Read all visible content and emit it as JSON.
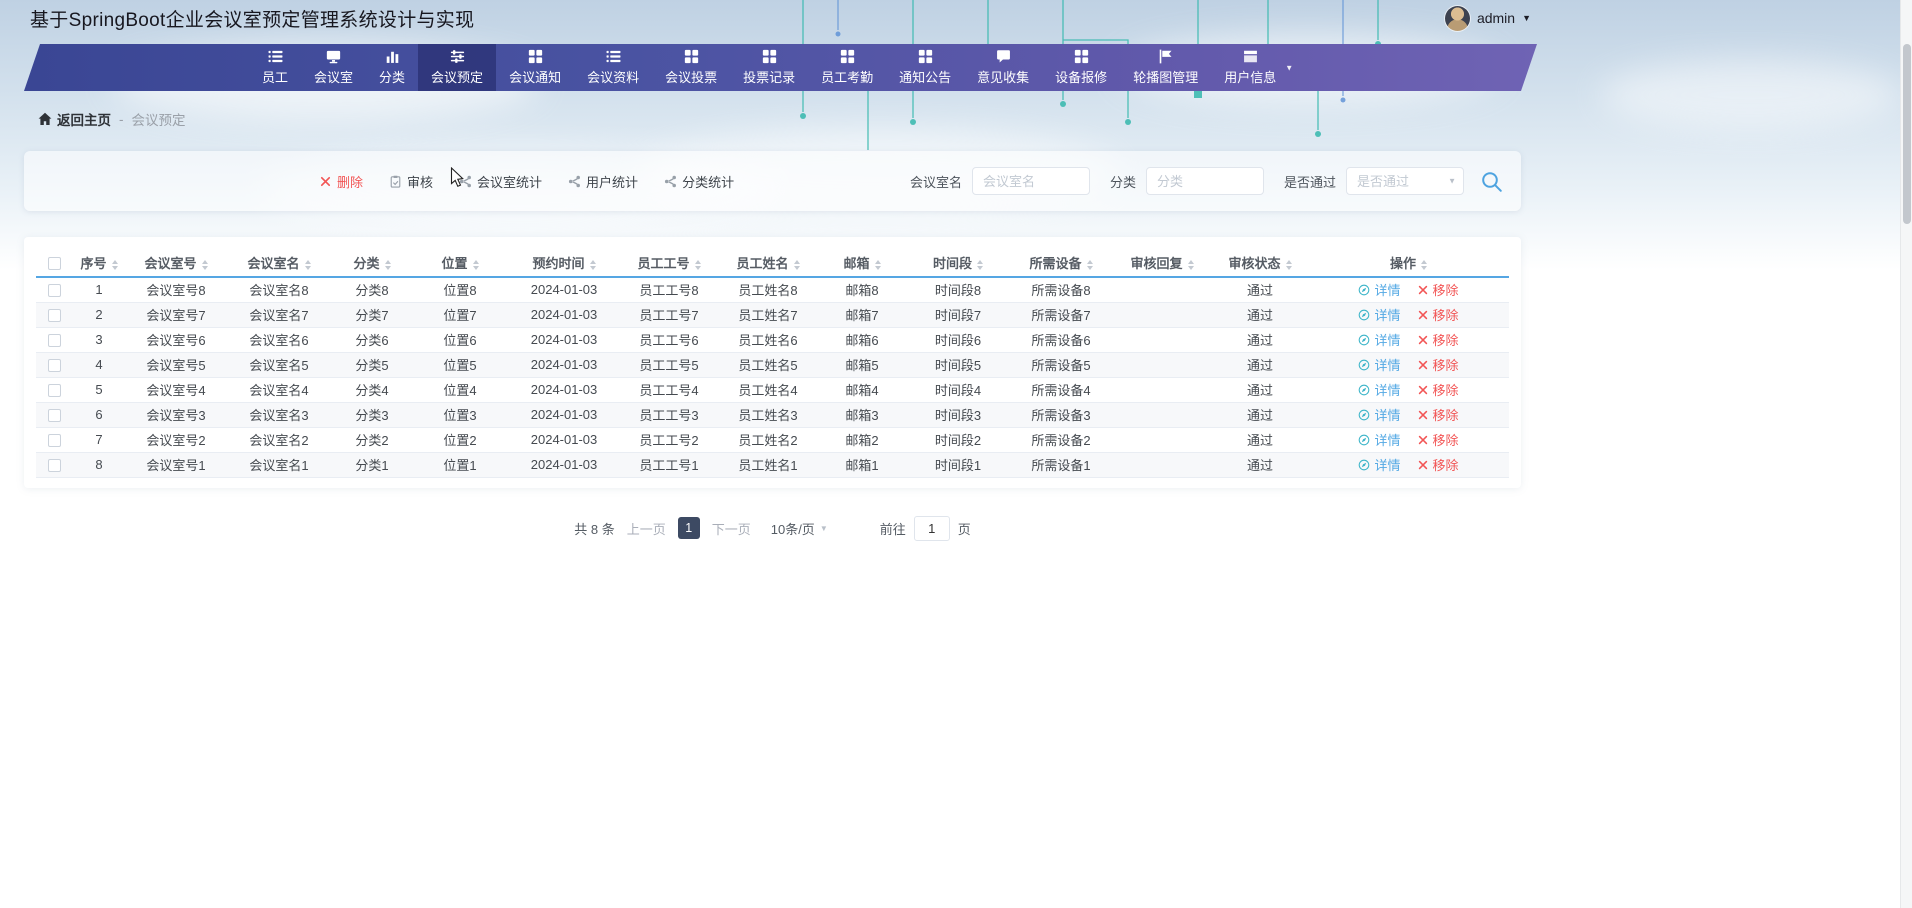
{
  "app": {
    "title": "基于SpringBoot企业会议室预定管理系统设计与实现",
    "user": {
      "name": "admin"
    }
  },
  "nav": {
    "items": [
      {
        "key": "staff",
        "label": "员工",
        "icon": "list-icon",
        "active": false,
        "caret": false
      },
      {
        "key": "meeting-room",
        "label": "会议室",
        "icon": "monitor-icon",
        "active": false,
        "caret": false
      },
      {
        "key": "category",
        "label": "分类",
        "icon": "bar-chart-icon",
        "active": false,
        "caret": false
      },
      {
        "key": "reservation",
        "label": "会议预定",
        "icon": "sliders-icon",
        "active": true,
        "caret": false
      },
      {
        "key": "meeting-notice",
        "label": "会议通知",
        "icon": "grid-icon",
        "active": false,
        "caret": false
      },
      {
        "key": "meeting-materials",
        "label": "会议资料",
        "icon": "list-icon",
        "active": false,
        "caret": false
      },
      {
        "key": "meeting-vote",
        "label": "会议投票",
        "icon": "grid-icon",
        "active": false,
        "caret": false
      },
      {
        "key": "vote-records",
        "label": "投票记录",
        "icon": "grid-icon",
        "active": false,
        "caret": false
      },
      {
        "key": "attendance",
        "label": "员工考勤",
        "icon": "grid-icon",
        "active": false,
        "caret": false
      },
      {
        "key": "announcements",
        "label": "通知公告",
        "icon": "grid-icon",
        "active": false,
        "caret": false
      },
      {
        "key": "feedback",
        "label": "意见收集",
        "icon": "chat-icon",
        "active": false,
        "caret": false
      },
      {
        "key": "equipment-repair",
        "label": "设备报修",
        "icon": "grid-icon",
        "active": false,
        "caret": false
      },
      {
        "key": "carousel",
        "label": "轮播图管理",
        "icon": "flag-icon",
        "active": false,
        "caret": false
      },
      {
        "key": "user-info",
        "label": "用户信息",
        "icon": "panel-icon",
        "active": false,
        "caret": true
      }
    ]
  },
  "breadcrumb": {
    "home": "返回主页",
    "separator": "-",
    "current": "会议预定"
  },
  "toolbar": {
    "actions": [
      {
        "key": "delete",
        "label": "删除",
        "icon": "close-icon",
        "danger": true
      },
      {
        "key": "audit",
        "label": "审核",
        "icon": "audit-icon",
        "danger": false
      },
      {
        "key": "room-stats",
        "label": "会议室统计",
        "icon": "share-icon",
        "danger": false
      },
      {
        "key": "user-stats",
        "label": "用户统计",
        "icon": "share-icon",
        "danger": false
      },
      {
        "key": "category-stats",
        "label": "分类统计",
        "icon": "share-icon",
        "danger": false
      }
    ],
    "filters": [
      {
        "key": "room-name",
        "label": "会议室名",
        "placeholder": "会议室名",
        "type": "input"
      },
      {
        "key": "category",
        "label": "分类",
        "placeholder": "分类",
        "type": "input"
      },
      {
        "key": "pass",
        "label": "是否通过",
        "placeholder": "是否通过",
        "type": "select"
      }
    ],
    "search_icon": "search-icon"
  },
  "table": {
    "columns": [
      "序号",
      "会议室号",
      "会议室名",
      "分类",
      "位置",
      "预约时间",
      "员工工号",
      "员工姓名",
      "邮箱",
      "时间段",
      "所需设备",
      "审核回复",
      "审核状态",
      "操作"
    ],
    "rows": [
      [
        "1",
        "会议室号8",
        "会议室名8",
        "分类8",
        "位置8",
        "2024-01-03",
        "员工工号8",
        "员工姓名8",
        "邮箱8",
        "时间段8",
        "所需设备8",
        "",
        "通过"
      ],
      [
        "2",
        "会议室号7",
        "会议室名7",
        "分类7",
        "位置7",
        "2024-01-03",
        "员工工号7",
        "员工姓名7",
        "邮箱7",
        "时间段7",
        "所需设备7",
        "",
        "通过"
      ],
      [
        "3",
        "会议室号6",
        "会议室名6",
        "分类6",
        "位置6",
        "2024-01-03",
        "员工工号6",
        "员工姓名6",
        "邮箱6",
        "时间段6",
        "所需设备6",
        "",
        "通过"
      ],
      [
        "4",
        "会议室号5",
        "会议室名5",
        "分类5",
        "位置5",
        "2024-01-03",
        "员工工号5",
        "员工姓名5",
        "邮箱5",
        "时间段5",
        "所需设备5",
        "",
        "通过"
      ],
      [
        "5",
        "会议室号4",
        "会议室名4",
        "分类4",
        "位置4",
        "2024-01-03",
        "员工工号4",
        "员工姓名4",
        "邮箱4",
        "时间段4",
        "所需设备4",
        "",
        "通过"
      ],
      [
        "6",
        "会议室号3",
        "会议室名3",
        "分类3",
        "位置3",
        "2024-01-03",
        "员工工号3",
        "员工姓名3",
        "邮箱3",
        "时间段3",
        "所需设备3",
        "",
        "通过"
      ],
      [
        "7",
        "会议室号2",
        "会议室名2",
        "分类2",
        "位置2",
        "2024-01-03",
        "员工工号2",
        "员工姓名2",
        "邮箱2",
        "时间段2",
        "所需设备2",
        "",
        "通过"
      ],
      [
        "8",
        "会议室号1",
        "会议室名1",
        "分类1",
        "位置1",
        "2024-01-03",
        "员工工号1",
        "员工姓名1",
        "邮箱1",
        "时间段1",
        "所需设备1",
        "",
        "通过"
      ]
    ],
    "row_actions": {
      "detail": "详情",
      "remove": "移除"
    }
  },
  "pagination": {
    "total": "共 8 条",
    "prev": "上一页",
    "active_page": "1",
    "next": "下一页",
    "size": "10条/页",
    "goto_label": "前往",
    "goto_value": "1",
    "goto_unit": "页"
  },
  "palette": {
    "nav_gradient_start": "#3a4694",
    "nav_gradient_end": "#6f63b4",
    "accent_blue": "#54a9e4",
    "danger_red": "#f25555",
    "link_teal": "#3db5c9",
    "header_divider_blue": "#55a6e3",
    "pagination_active_bg": "#3d4a63"
  }
}
